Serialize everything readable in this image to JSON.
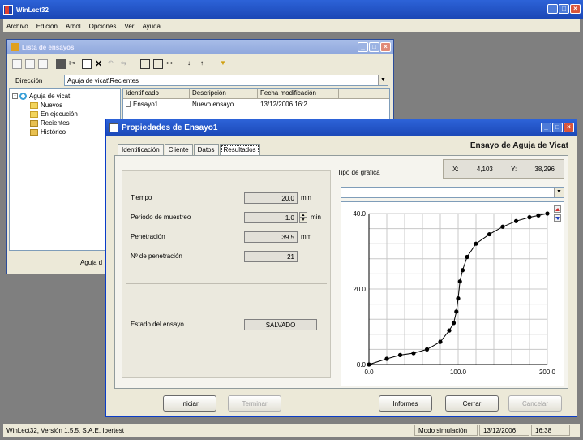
{
  "app": {
    "title": "WinLect32",
    "menu": [
      "Archivo",
      "Edición",
      "Arbol",
      "Opciones",
      "Ver",
      "Ayuda"
    ]
  },
  "list_window": {
    "title": "Lista de ensayos",
    "direccion_label": "Dirección",
    "direccion_value": "Aguja de vicat\\Recientes",
    "tree": [
      {
        "label": "Aguja de vicat",
        "level": 0
      },
      {
        "label": "Nuevos",
        "level": 1
      },
      {
        "label": "En ejecución",
        "level": 1
      },
      {
        "label": "Recientes",
        "level": 1
      },
      {
        "label": "Histórico",
        "level": 1
      }
    ],
    "columns": [
      "Identificado",
      "Descripción",
      "Fecha modificación"
    ],
    "rows": [
      {
        "id": "Ensayo1",
        "desc": "Nuevo ensayo",
        "date": "13/12/2006  16:2..."
      }
    ],
    "footer_text": "Aguja d"
  },
  "props_window": {
    "title": "Propiedades de  Ensayo1",
    "header_title": "Ensayo de Aguja de Vicat",
    "tabs": [
      "Identificación",
      "Cliente",
      "Datos",
      "Resultados"
    ],
    "active_tab": 3,
    "fields": {
      "tiempo": {
        "label": "Tiempo",
        "value": "20.0",
        "unit": "min"
      },
      "periodo": {
        "label": "Periodo de muestreo",
        "value": "1.0",
        "unit": "min"
      },
      "penetracion": {
        "label": "Penetración",
        "value": "39.5",
        "unit": "mm"
      },
      "n_penetracion": {
        "label": "Nº de penetración",
        "value": "21"
      }
    },
    "estado": {
      "label": "Estado del ensayo",
      "value": "SALVADO"
    },
    "tipo_grafica_label": "Tipo de gráfica",
    "coords": {
      "x_label": "X:",
      "x_value": "4,103",
      "y_label": "Y:",
      "y_value": "38,296"
    },
    "buttons": {
      "iniciar": "Iniciar",
      "terminar": "Terminar",
      "informes": "Informes",
      "cerrar": "Cerrar",
      "cancelar": "Cancelar"
    },
    "icon_up": "arrow-up-icon",
    "icon_down": "arrow-down-icon"
  },
  "status_bar": {
    "version": "WinLect32, Versión 1.5.5. S.A.E. Ibertest",
    "mode": "Modo simulación",
    "date": "13/12/2006",
    "time": "16:38"
  },
  "chart_data": {
    "type": "scatter",
    "x": [
      0,
      20,
      35,
      50,
      65,
      80,
      90,
      95,
      98,
      100,
      102,
      105,
      110,
      120,
      135,
      150,
      165,
      180,
      190,
      200
    ],
    "y": [
      0,
      1.5,
      2.5,
      3,
      4,
      6,
      9,
      11,
      14,
      17.5,
      22,
      25,
      28.5,
      32,
      34.5,
      36.5,
      38,
      39,
      39.5,
      40
    ],
    "x_ticks": [
      "0.0",
      "100.0",
      "200.0"
    ],
    "y_ticks": [
      "0.0",
      "20.0",
      "40.0"
    ],
    "xlim": [
      0,
      200
    ],
    "ylim": [
      0,
      40
    ],
    "grid": true,
    "colors": {
      "line": "#000000",
      "marker": "#000000",
      "grid": "#c8c8c8"
    }
  }
}
